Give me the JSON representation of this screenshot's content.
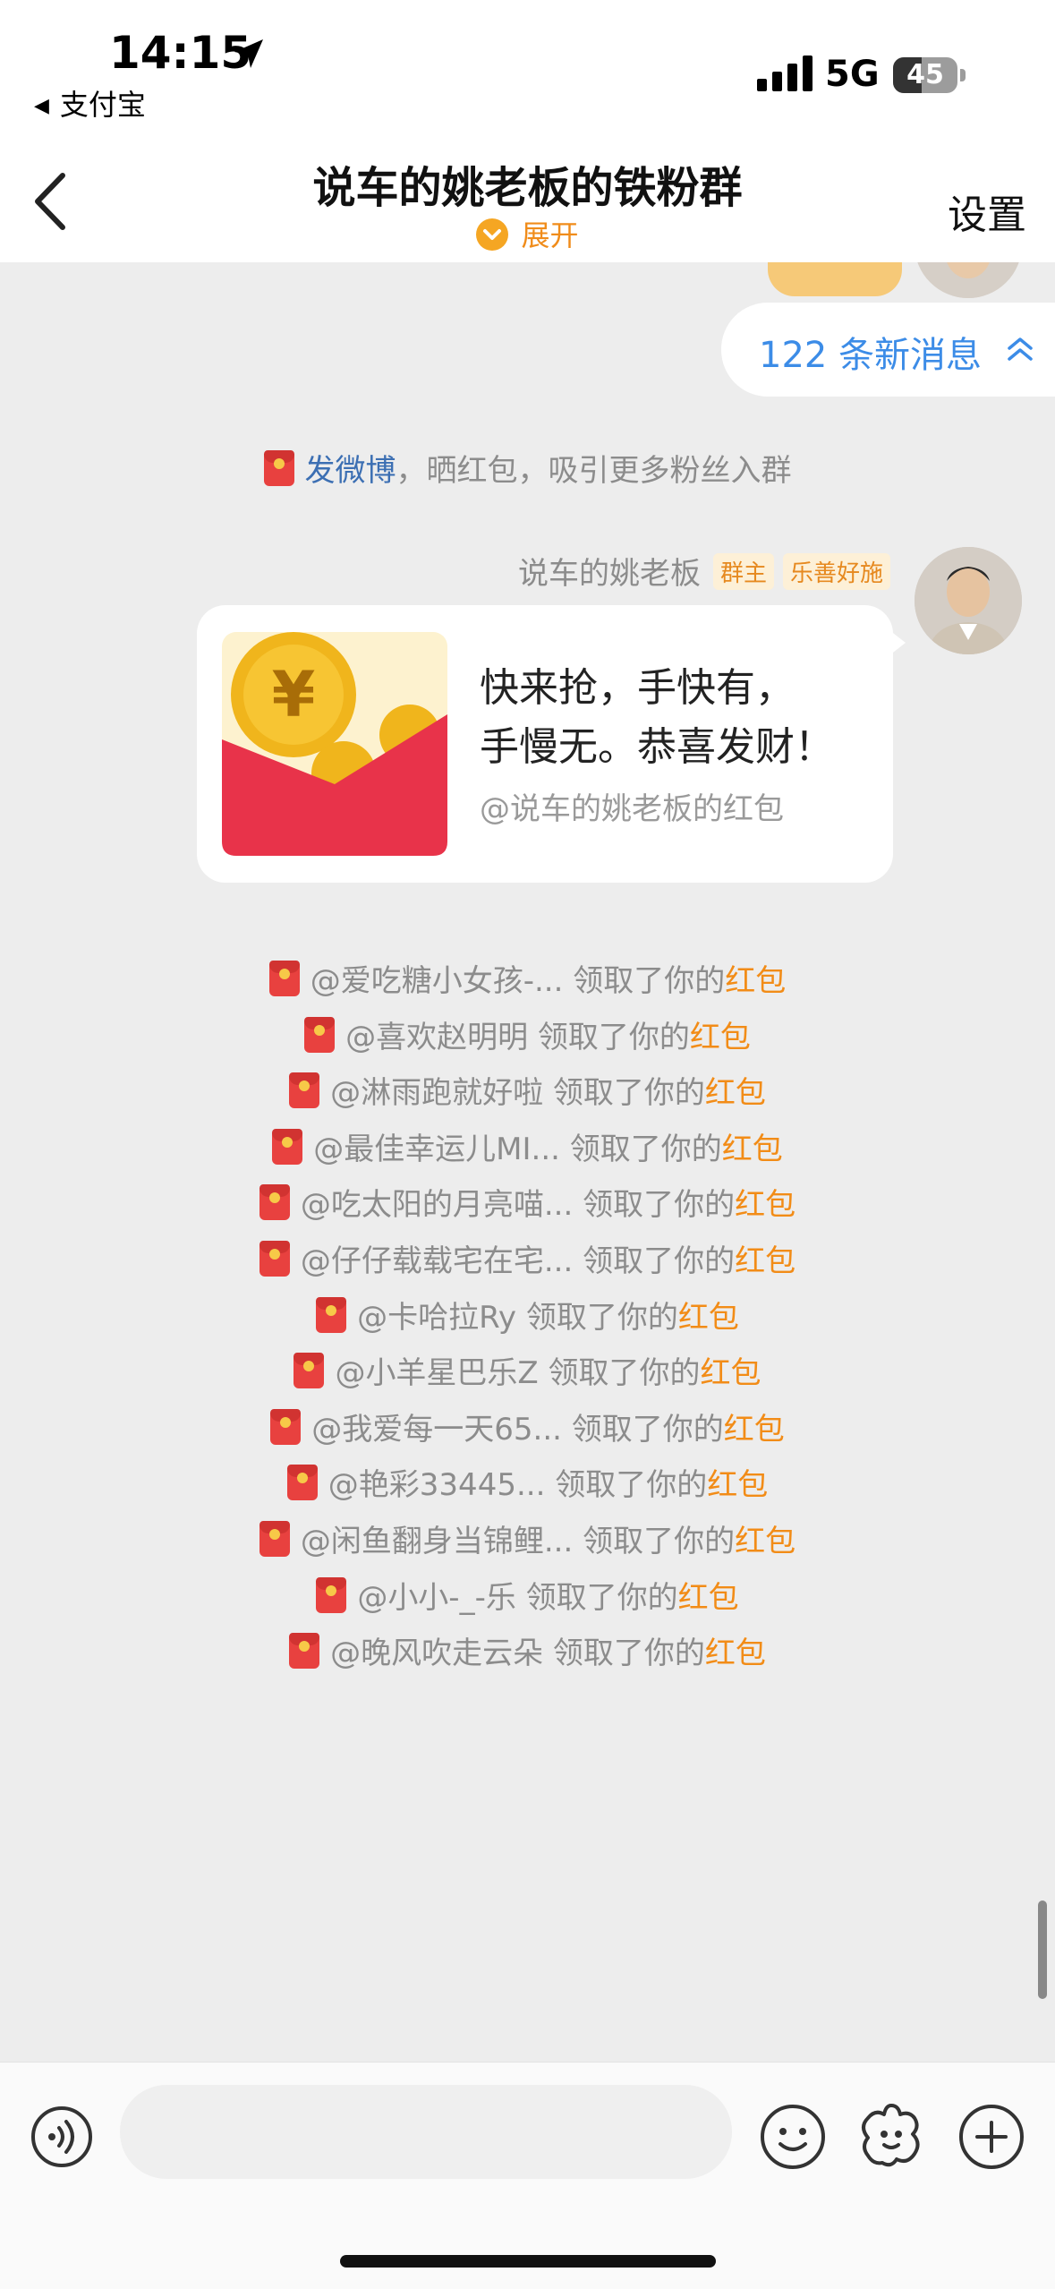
{
  "status_bar": {
    "time": "14:15",
    "back_app": "支付宝",
    "network": "5G",
    "battery": "45",
    "battery_level_pct": 45
  },
  "header": {
    "title": "说车的姚老板的铁粉群",
    "expand_label": "展开",
    "settings_label": "设置"
  },
  "new_messages": {
    "label": "122 条新消息"
  },
  "system_notice": {
    "link_text": "发微博",
    "rest_text": "，晒红包，吸引更多粉丝入群"
  },
  "message": {
    "sender": "说车的姚老板",
    "badge_owner": "群主",
    "badge_title": "乐善好施",
    "line1": "快来抢，手快有，",
    "line2": "手慢无。恭喜发财！",
    "subtitle": "@说车的姚老板的红包"
  },
  "claim_suffix": "领取了你的",
  "claim_highlight": "红包",
  "claims": [
    "@爱吃糖小女孩-...",
    "@喜欢赵明明",
    "@淋雨跑就好啦",
    "@最佳幸运儿MI...",
    "@吃太阳的月亮喵...",
    "@仔仔载载宅在宅...",
    "@卡哈拉Ry",
    "@小羊星巴乐Z",
    "@我爱每一天65...",
    "@艳彩33445...",
    "@闲鱼翻身当锦鲤...",
    "@小小-_-乐",
    "@晚风吹走云朵"
  ],
  "colors": {
    "accent_orange": "#f28c17",
    "link_blue": "#3c8ce7",
    "red_packet": "#e8413f"
  },
  "icons": [
    "location-arrow-icon",
    "signal-icon",
    "back-chevron-icon",
    "expand-chevron-icon",
    "double-chevron-up-icon",
    "red-packet-icon",
    "voice-icon",
    "emoji-icon",
    "sticker-icon",
    "plus-icon"
  ]
}
